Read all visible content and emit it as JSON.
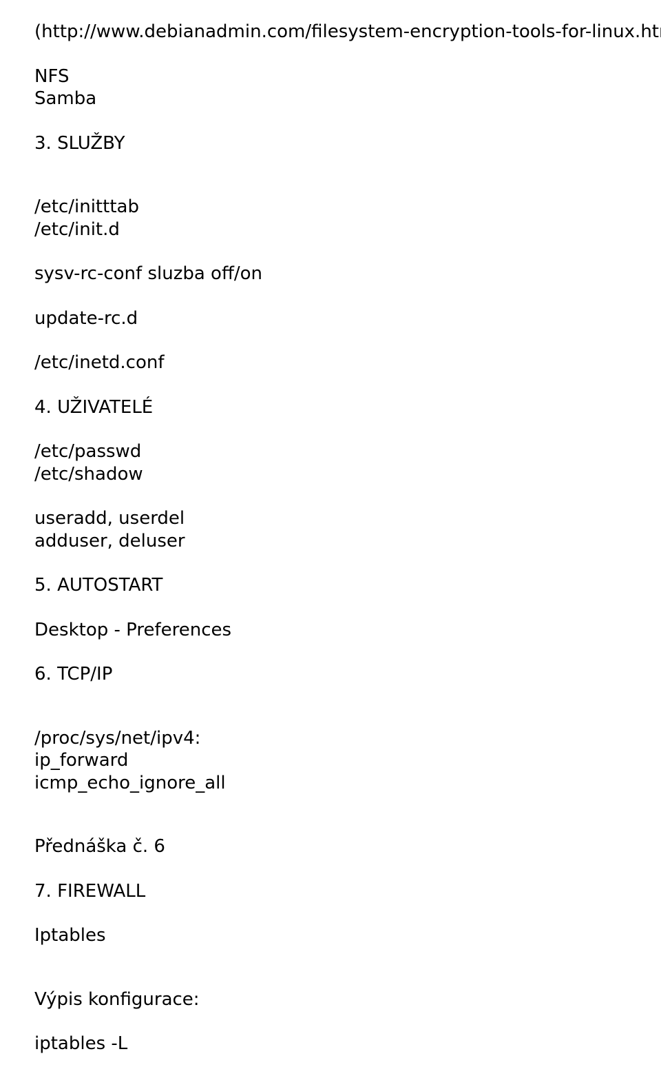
{
  "lines": {
    "l1": "(http://www.debianadmin.com/filesystem-encryption-tools-for-linux.html)",
    "l2": "NFS",
    "l3": "Samba",
    "l4": "3. SLUŽBY",
    "l5": "/etc/initttab",
    "l6": "/etc/init.d",
    "l7": "sysv-rc-conf sluzba off/on",
    "l8": "update-rc.d",
    "l9": "/etc/inetd.conf",
    "l10": "4. UŽIVATELÉ",
    "l11": "/etc/passwd",
    "l12": "/etc/shadow",
    "l13": "useradd, userdel",
    "l14": "adduser, deluser",
    "l15": "5. AUTOSTART",
    "l16": "Desktop - Preferences",
    "l17": "6. TCP/IP",
    "l18": "/proc/sys/net/ipv4:",
    "l19": "ip_forward",
    "l20": "icmp_echo_ignore_all",
    "l21": "Přednáška č. 6",
    "l22": "7. FIREWALL",
    "l23": "Iptables",
    "l24": "Výpis konfigurace:",
    "l25": "iptables -L"
  }
}
